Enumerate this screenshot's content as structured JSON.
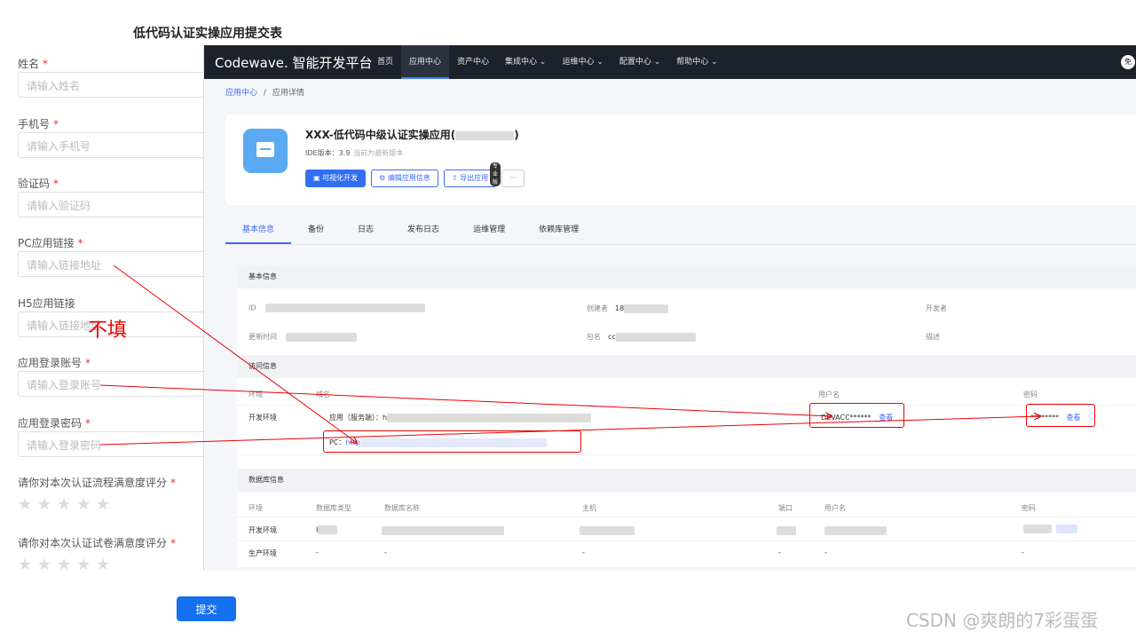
{
  "form": {
    "title": "低代码认证实操应用提交表",
    "fields": [
      {
        "label": "姓名",
        "placeholder": "请输入姓名"
      },
      {
        "label": "手机号",
        "placeholder": "请输入手机号"
      },
      {
        "label": "验证码",
        "placeholder": "请输入验证码"
      },
      {
        "label": "PC应用链接",
        "placeholder": "请输入链接地址"
      },
      {
        "label": "H5应用链接",
        "placeholder": "请输入链接地址"
      },
      {
        "label": "应用登录账号",
        "placeholder": "请输入登录账号"
      },
      {
        "label": "应用登录密码",
        "placeholder": "请输入登录密码"
      }
    ],
    "required_mark": "*",
    "rating1": "请你对本次认证流程满意度评分",
    "rating2": "请你对本次认证试卷满意度评分",
    "submit": "提交",
    "no_fill_note": "不填"
  },
  "screenshot": {
    "logo": "Codewave. 智能开发平台",
    "nav": [
      "首页",
      "应用中心",
      "资产中心",
      "集成中心 ⌄",
      "运维中心 ⌄",
      "配置中心 ⌄",
      "帮助中心 ⌄"
    ],
    "avatar": "免",
    "breadcrumb": {
      "root": "应用中心",
      "sep": "/",
      "current": "应用详情"
    },
    "app": {
      "name": "XXX-低代码中级认证实操应用(",
      "name_end": ")",
      "ide_label": "IDE版本：3.9",
      "ide_latest": "当前为最新版本",
      "btn_visual": "可视化开发",
      "btn_edit": "编辑应用信息",
      "btn_export": "导出应用",
      "pro_badge": "专业版",
      "btn_more": "···"
    },
    "tabs": [
      "基本信息",
      "备份",
      "日志",
      "发布日志",
      "运维管理",
      "依赖库管理"
    ],
    "basic": {
      "title": "基本信息",
      "id_label": "ID",
      "creator_label": "创建者",
      "creator_value": "18",
      "developer_label": "开发者",
      "updated_label": "更新时间",
      "package_label": "包名",
      "package_value": "cc",
      "desc_label": "描述"
    },
    "access": {
      "title": "访问信息",
      "headers": [
        "环境",
        "域名",
        "用户名",
        "密码"
      ],
      "env": "开发环境",
      "server_app": "应用（服务端）：h",
      "pc_label": "PC：",
      "pc_link": "http",
      "username": "DEVACC******",
      "password": "********",
      "view": "查看"
    },
    "db": {
      "title": "数据库信息",
      "headers": [
        "环境",
        "数据库类型",
        "数据库名称",
        "主机",
        "端口",
        "用户名",
        "密码"
      ],
      "rows": [
        {
          "env": "开发环境",
          "type": "I",
          "name": "",
          "host": "",
          "port": "",
          "user": "",
          "pwd": ""
        },
        {
          "env": "生产环境",
          "type": "-",
          "name": "-",
          "host": "-",
          "port": "-",
          "user": "-",
          "pwd": "-"
        }
      ]
    }
  },
  "watermark": "CSDN @爽朗的7彩蛋蛋",
  "colors": {
    "accent": "#1570ef",
    "annotation": "#e00000",
    "topbar": "#1d2129"
  }
}
